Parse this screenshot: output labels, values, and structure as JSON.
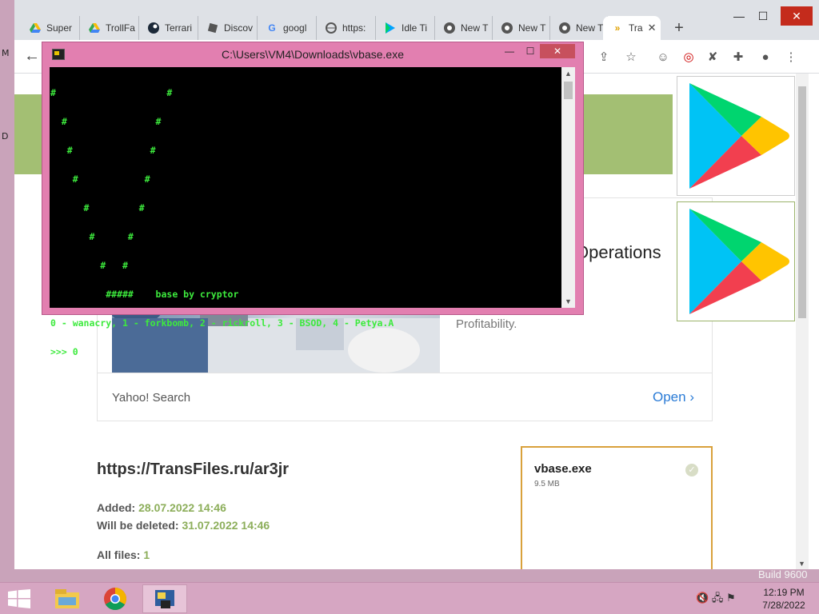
{
  "desktop": {
    "icon_letters": [
      "M",
      "D"
    ],
    "build_label": "Build 9600"
  },
  "browser": {
    "tabs": [
      {
        "label": "Super",
        "icon": "drive-icon"
      },
      {
        "label": "TrollFa",
        "icon": "drive-icon"
      },
      {
        "label": "Terrari",
        "icon": "steam-icon"
      },
      {
        "label": "Discov",
        "icon": "roblox-icon"
      },
      {
        "label": "googl",
        "icon": "google-icon"
      },
      {
        "label": "https:",
        "icon": "globe-icon"
      },
      {
        "label": "Idle Ti",
        "icon": "play-store-icon"
      },
      {
        "label": "New T",
        "icon": "chrome-icon"
      },
      {
        "label": "New T",
        "icon": "chrome-icon"
      },
      {
        "label": "New T",
        "icon": "chrome-icon"
      },
      {
        "label": "Tra",
        "icon": "transfiles-icon",
        "active": true
      }
    ],
    "window_controls": {
      "minimize": "—",
      "maximize": "☐",
      "close": "✕"
    },
    "page": {
      "ad": {
        "title_fragment": "Operations",
        "description": "Software that\nQuality &\nProfitability.",
        "source": "Yahoo! Search",
        "open_label": "Open"
      },
      "file_url": "https://TransFiles.ru/ar3jr",
      "added_label": "Added:",
      "added_value": "28.07.2022 14:46",
      "deleted_label": "Will be deleted:",
      "deleted_value": "31.07.2022 14:46",
      "all_files_label": "All files:",
      "all_files_value": "1",
      "file_card": {
        "name": "vbase.exe",
        "size": "9.5 MB"
      }
    }
  },
  "console": {
    "title": "C:\\Users\\VM4\\Downloads\\vbase.exe",
    "controls": {
      "minimize": "—",
      "maximize": "☐",
      "close": "✕"
    },
    "lines": [
      "#                    #",
      "  #                #",
      "   #              #",
      "    #            #",
      "      #         #",
      "       #      #",
      "         #   #",
      "          #####    base by cryptor",
      "0 - wanacry, 1 - forkbomb, 2 - rickroll, 3 - BSOD, 4 - Petya.A",
      ">>> 0"
    ]
  },
  "taskbar": {
    "items": [
      "file-explorer",
      "chrome",
      "vbase-console"
    ],
    "clock_time": "12:19 PM",
    "clock_date": "7/28/2022"
  }
}
